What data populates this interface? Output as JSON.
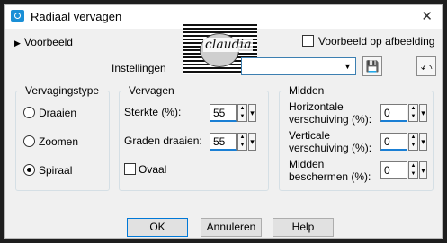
{
  "window": {
    "title": "Radiaal vervagen",
    "close_glyph": "✕"
  },
  "preview": {
    "toggle_label": "Voorbeeld",
    "thumbnail_text": "claudia"
  },
  "preview_on_image": {
    "label": "Voorbeeld op afbeelding",
    "checked": false
  },
  "settings": {
    "label": "Instellingen",
    "preset_value": ""
  },
  "vervagingstype": {
    "title": "Vervagingstype",
    "options": [
      {
        "label": "Draaien",
        "selected": false
      },
      {
        "label": "Zoomen",
        "selected": false
      },
      {
        "label": "Spiraal",
        "selected": true
      }
    ]
  },
  "vervagen": {
    "title": "Vervagen",
    "sterkte_label": "Sterkte (%):",
    "sterkte_value": "55",
    "graden_label": "Graden draaien:",
    "graden_value": "55",
    "ovaal_label": "Ovaal",
    "ovaal_checked": false
  },
  "midden": {
    "title": "Midden",
    "h_label_1": "Horizontale",
    "h_label_2": "verschuiving (%):",
    "h_value": "0",
    "v_label_1": "Verticale",
    "v_label_2": "verschuiving (%):",
    "v_value": "0",
    "p_label_1": "Midden",
    "p_label_2": "beschermen (%):",
    "p_value": "0"
  },
  "buttons": {
    "ok": "OK",
    "cancel": "Annuleren",
    "help": "Help"
  },
  "icons": {
    "app": "app-icon",
    "save": "save-preset-icon",
    "reset": "reset-defaults-icon",
    "dropdown": "chevron-down-icon"
  }
}
